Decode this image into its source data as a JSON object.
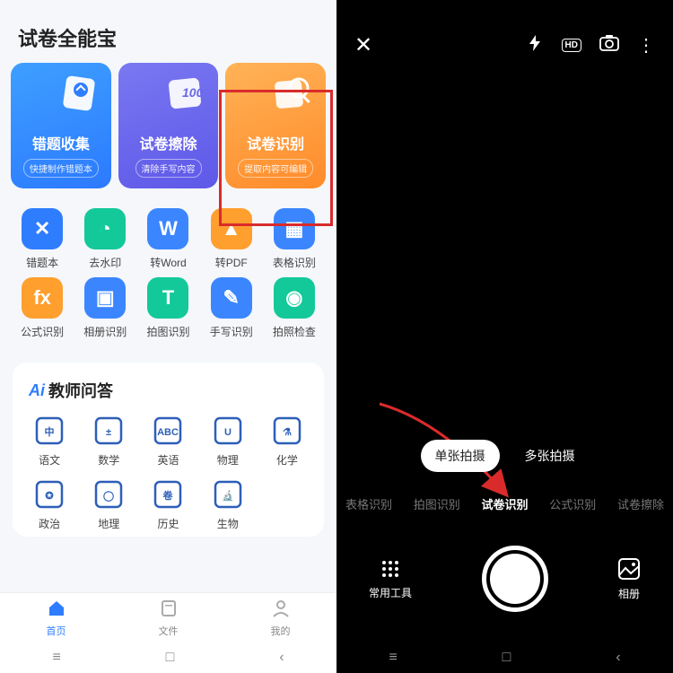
{
  "left": {
    "app_title": "试卷全能宝",
    "cards": [
      {
        "title": "错题收集",
        "sub": "快捷制作错题本"
      },
      {
        "title": "试卷擦除",
        "sub": "清除手写内容"
      },
      {
        "title": "试卷识别",
        "sub": "提取内容可编辑"
      }
    ],
    "grid": [
      {
        "label": "错题本",
        "bg": "#2f7dff",
        "glyph": "✕"
      },
      {
        "label": "去水印",
        "bg": "#13c99a",
        "glyph": "◔"
      },
      {
        "label": "转Word",
        "bg": "#3b86ff",
        "glyph": "W"
      },
      {
        "label": "转PDF",
        "bg": "#ff9f2e",
        "glyph": "▲"
      },
      {
        "label": "表格识别",
        "bg": "#3b86ff",
        "glyph": "▦"
      },
      {
        "label": "公式识别",
        "bg": "#ff9f2e",
        "glyph": "fx"
      },
      {
        "label": "相册识别",
        "bg": "#3b86ff",
        "glyph": "▣"
      },
      {
        "label": "拍图识别",
        "bg": "#13c99a",
        "glyph": "T"
      },
      {
        "label": "手写识别",
        "bg": "#3b86ff",
        "glyph": "✎"
      },
      {
        "label": "拍照检查",
        "bg": "#13c99a",
        "glyph": "◉"
      }
    ],
    "section_title_prefix": "Ai",
    "section_title": "教师问答",
    "subjects": [
      {
        "label": "语文",
        "glyph": "中"
      },
      {
        "label": "数学",
        "glyph": "±"
      },
      {
        "label": "英语",
        "glyph": "ABC"
      },
      {
        "label": "物理",
        "glyph": "U"
      },
      {
        "label": "化学",
        "glyph": "⚗"
      },
      {
        "label": "政治",
        "glyph": "✪"
      },
      {
        "label": "地理",
        "glyph": "◯"
      },
      {
        "label": "历史",
        "glyph": "卷"
      },
      {
        "label": "生物",
        "glyph": "🔬"
      }
    ],
    "nav": [
      {
        "label": "首页",
        "glyph": "⌂",
        "active": true
      },
      {
        "label": "文件",
        "glyph": "▭",
        "active": false
      },
      {
        "label": "我的",
        "glyph": "◯",
        "active": false
      }
    ]
  },
  "right": {
    "tools": {
      "flash": "⚡",
      "hd": "HD",
      "camera": "⌷",
      "more": "⋮"
    },
    "shot_modes": [
      {
        "label": "单张拍摄",
        "active": true
      },
      {
        "label": "多张拍摄",
        "active": false
      }
    ],
    "mode_tabs": [
      {
        "label": "表格识别",
        "active": false
      },
      {
        "label": "拍图识别",
        "active": false
      },
      {
        "label": "试卷识别",
        "active": true
      },
      {
        "label": "公式识别",
        "active": false
      },
      {
        "label": "试卷擦除",
        "active": false
      }
    ],
    "bottom": {
      "tools_label": "常用工具",
      "album_label": "相册"
    }
  }
}
